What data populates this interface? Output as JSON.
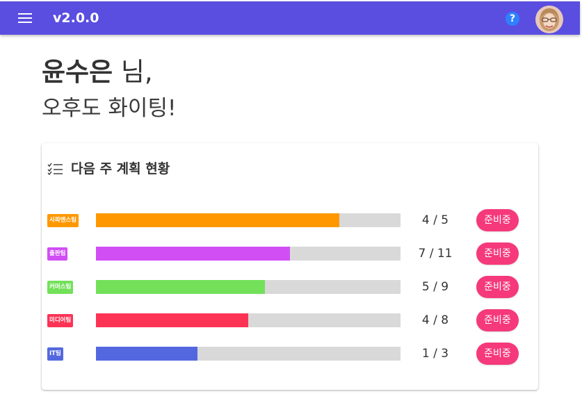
{
  "appbar": {
    "version": "v2.0.0",
    "background_color": "#594ee0",
    "menu_icon": "hamburger-menu-icon",
    "help_icon": "help-circle-icon",
    "help_symbol": "?",
    "avatar": "user-avatar"
  },
  "greeting": {
    "name": "윤수은",
    "honorific": " 님,",
    "message": "오후도 화이팅!"
  },
  "plan_card": {
    "icon": "checklist-icon",
    "title": "다음 주 계획 현황",
    "teams": [
      {
        "tag": "사파엔스팀",
        "count": "4 / 5",
        "done": 4,
        "total": 5,
        "color": "#ff9800",
        "status": "준비중"
      },
      {
        "tag": "출판팀",
        "count": "7 / 11",
        "done": 7,
        "total": 11,
        "color": "#d14ef5",
        "status": "준비중"
      },
      {
        "tag": "커머스팀",
        "count": "5 / 9",
        "done": 5,
        "total": 9,
        "color": "#73e05a",
        "status": "준비중"
      },
      {
        "tag": "미디어팀",
        "count": "4 / 8",
        "done": 4,
        "total": 8,
        "color": "#fc3355",
        "status": "준비중"
      },
      {
        "tag": "IT팀",
        "count": "1 / 3",
        "done": 1,
        "total": 3,
        "color": "#5368df",
        "status": "준비중"
      }
    ],
    "status_button_color": "#f5397b"
  }
}
